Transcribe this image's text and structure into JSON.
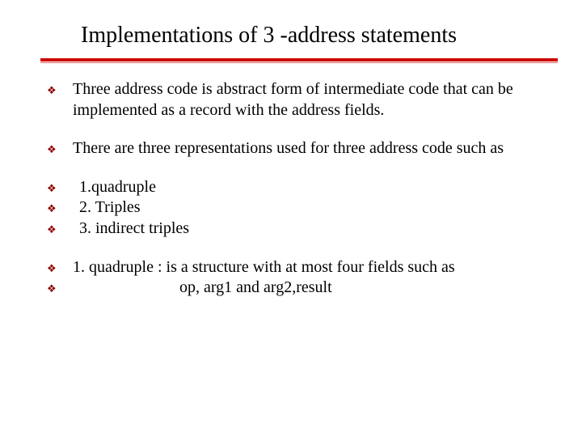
{
  "title": "Implementations of 3 -address statements",
  "bullets": {
    "b1": "Three address code is abstract form of  intermediate code that can be implemented as a record with the address fields.",
    "b2": "There are three representations  used for three address code such as",
    "b3": " 1.quadruple",
    "b4": "2. Triples",
    "b5": " 3. indirect triples",
    "b6_l1": "1. quadruple   : is a structure with at most four fields such as",
    "b6_l2": "op, arg1 and arg2,result"
  }
}
